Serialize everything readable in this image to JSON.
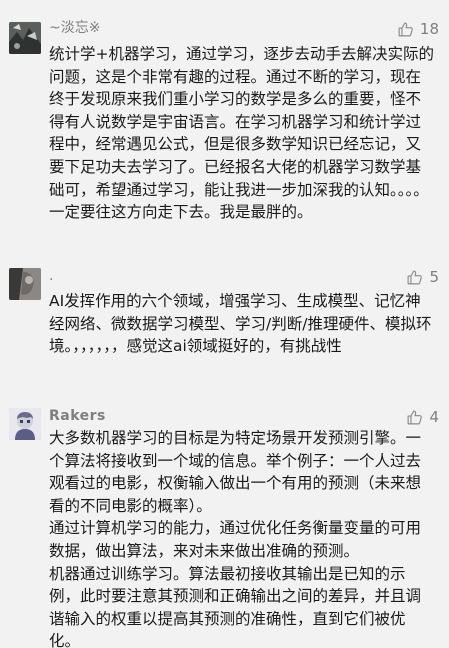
{
  "comments": [
    {
      "username": "~淡忘※",
      "likes": "18",
      "text": "统计学+机器学习，通过学习，逐步去动手去解决实际的问题，这是个非常有趣的过程。通过不断的学习，现在终于发现原来我们重小学习的数学是多么的重要，怪不得有人说数学是宇宙语言。在学习机器学习和统计学过程中，经常遇见公式，但是很多数学知识已经忘记，又要下足功夫去学习了。已经报名大佬的机器学习数学基础可，希望通过学习，能让我进一步加深我的认知。。。。一定要往这方向走下去。我是最胖的。"
    },
    {
      "username": ".",
      "likes": "5",
      "text": "AI发挥作用的六个领域，增强学习、生成模型、记忆神经网络、微数据学习模型、学习/判断/推理硬件、模拟环境。，，，，，，感觉这ai领域挺好的，有挑战性"
    },
    {
      "username": "Rakers",
      "likes": "4",
      "paragraphs": [
        "大多数机器学习的目标是为特定场景开发预测引擎。一个算法将接收到一个域的信息。举个例子：一个人过去观看过的电影，权衡输入做出一个有用的预测（未来想看的不同电影的概率）。",
        "通过计算机学习的能力，通过优化任务衡量变量的可用数据，做出算法，来对未来做出准确的预测。",
        "机器通过训练学习。算法最初接收其输出是已知的示例，此时要注意其预测和正确输出之间的差异，并且调谐输入的权重以提高其预测的准确性，直到它们被优化。"
      ]
    }
  ]
}
